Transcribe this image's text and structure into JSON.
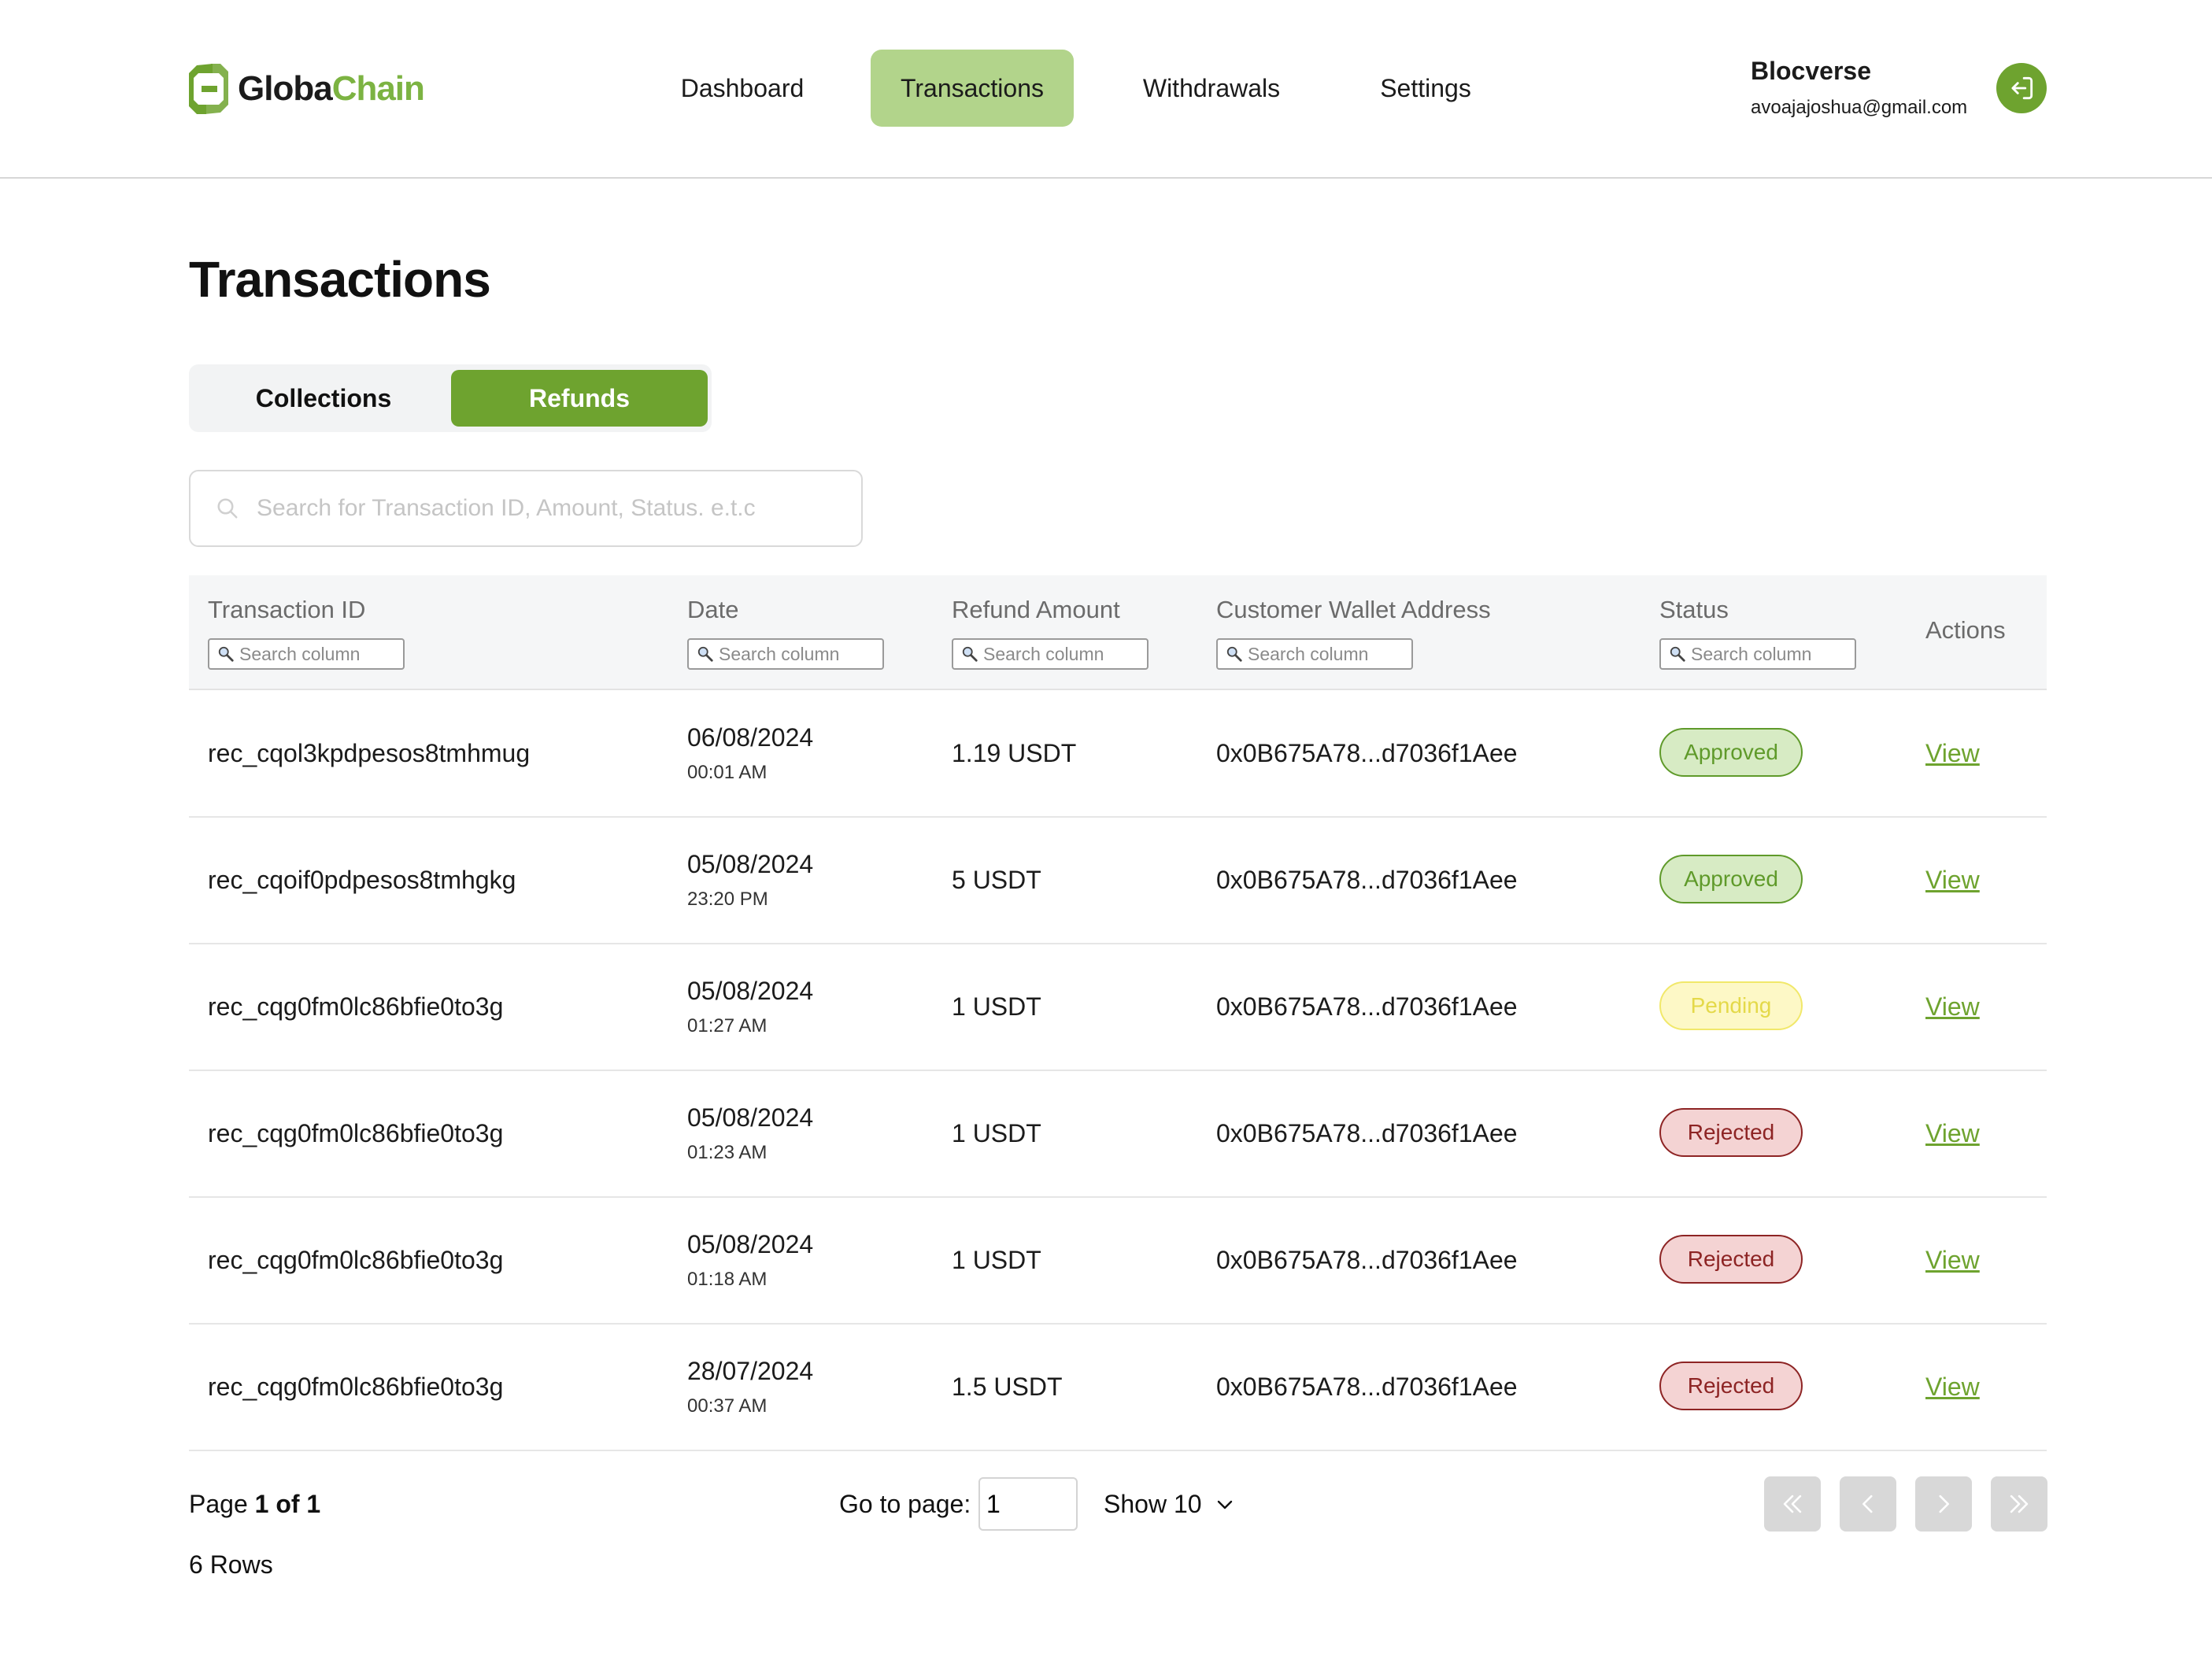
{
  "header": {
    "logo": {
      "part1": "Globa",
      "part2": "Chain"
    },
    "nav": [
      "Dashboard",
      "Transactions",
      "Withdrawals",
      "Settings"
    ],
    "active_nav": "Transactions",
    "user": {
      "name": "Blocverse",
      "email": "avoajajoshua@gmail.com"
    }
  },
  "page": {
    "title": "Transactions",
    "tabs": [
      "Collections",
      "Refunds"
    ],
    "active_tab": "Refunds",
    "search_placeholder": "Search for Transaction ID, Amount, Status. e.t.c",
    "search_value": ""
  },
  "table": {
    "columns": [
      "Transaction ID",
      "Date",
      "Refund Amount",
      "Customer Wallet Address",
      "Status",
      "Actions"
    ],
    "column_search_placeholder": "Search column",
    "rows": [
      {
        "id": "rec_cqol3kpdpesos8tmhmug",
        "date": "06/08/2024",
        "time": "00:01 AM",
        "amount": "1.19 USDT",
        "wallet": "0x0B675A78...d7036f1Aee",
        "status": "Approved",
        "action": "View"
      },
      {
        "id": "rec_cqoif0pdpesos8tmhgkg",
        "date": "05/08/2024",
        "time": "23:20 PM",
        "amount": "5 USDT",
        "wallet": "0x0B675A78...d7036f1Aee",
        "status": "Approved",
        "action": "View"
      },
      {
        "id": "rec_cqg0fm0lc86bfie0to3g",
        "date": "05/08/2024",
        "time": "01:27 AM",
        "amount": "1 USDT",
        "wallet": "0x0B675A78...d7036f1Aee",
        "status": "Pending",
        "action": "View"
      },
      {
        "id": "rec_cqg0fm0lc86bfie0to3g",
        "date": "05/08/2024",
        "time": "01:23 AM",
        "amount": "1 USDT",
        "wallet": "0x0B675A78...d7036f1Aee",
        "status": "Rejected",
        "action": "View"
      },
      {
        "id": "rec_cqg0fm0lc86bfie0to3g",
        "date": "05/08/2024",
        "time": "01:18 AM",
        "amount": "1 USDT",
        "wallet": "0x0B675A78...d7036f1Aee",
        "status": "Rejected",
        "action": "View"
      },
      {
        "id": "rec_cqg0fm0lc86bfie0to3g",
        "date": "28/07/2024",
        "time": "00:37 AM",
        "amount": "1.5 USDT",
        "wallet": "0x0B675A78...d7036f1Aee",
        "status": "Rejected",
        "action": "View"
      }
    ]
  },
  "pagination": {
    "page_label": "Page",
    "page_range": "1 of 1",
    "rows_label": "6 Rows",
    "goto_label": "Go to page:",
    "goto_value": "1",
    "show_label": "Show 10",
    "buttons": [
      "first-page",
      "previous-page",
      "next-page",
      "last-page"
    ]
  },
  "colors": {
    "accent": "#6ea32f",
    "nav_active_bg": "#b2d48b",
    "approved": "#5f9a2a",
    "pending": "#e4d949",
    "rejected": "#8d2424"
  }
}
